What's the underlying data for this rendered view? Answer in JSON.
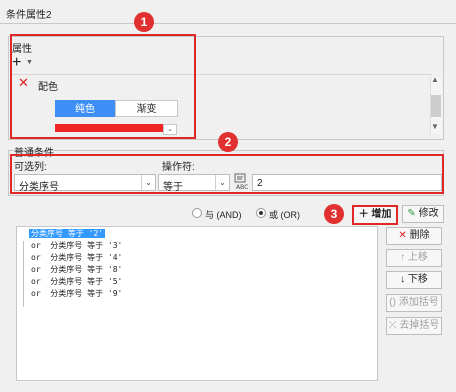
{
  "window": {
    "title": "条件属性2"
  },
  "property": {
    "group_label": "属性",
    "add_label": "+",
    "item_label": "配色",
    "tabs": [
      "纯色",
      "渐变"
    ],
    "color": "#f02626"
  },
  "condition": {
    "group_label": "普通条件",
    "column_label": "可选列:",
    "operator_label": "操作符:",
    "column_value": "分类序号",
    "operator_value": "等于",
    "value": "2"
  },
  "logic": {
    "and_label": "与 (AND)",
    "or_label": "或 (OR)",
    "selected": "or"
  },
  "buttons": {
    "add": "增加",
    "modify": "修改",
    "delete": "删除",
    "move_up": "上移",
    "move_down": "下移",
    "add_bracket": "添加括号",
    "remove_bracket": "去掉括号"
  },
  "tree": {
    "rows": [
      "分类序号 等于 '2'",
      "or  分类序号 等于 '3'",
      "or  分类序号 等于 '4'",
      "or  分类序号 等于 '8'",
      "or  分类序号 等于 '5'",
      "or  分类序号 等于 '9'"
    ]
  },
  "annotations": {
    "badge1": "1",
    "badge2": "2",
    "badge3": "3"
  },
  "colors": {
    "accent": "#3d8ff5",
    "highlight": "#e02828",
    "selection": "#3399ff"
  }
}
